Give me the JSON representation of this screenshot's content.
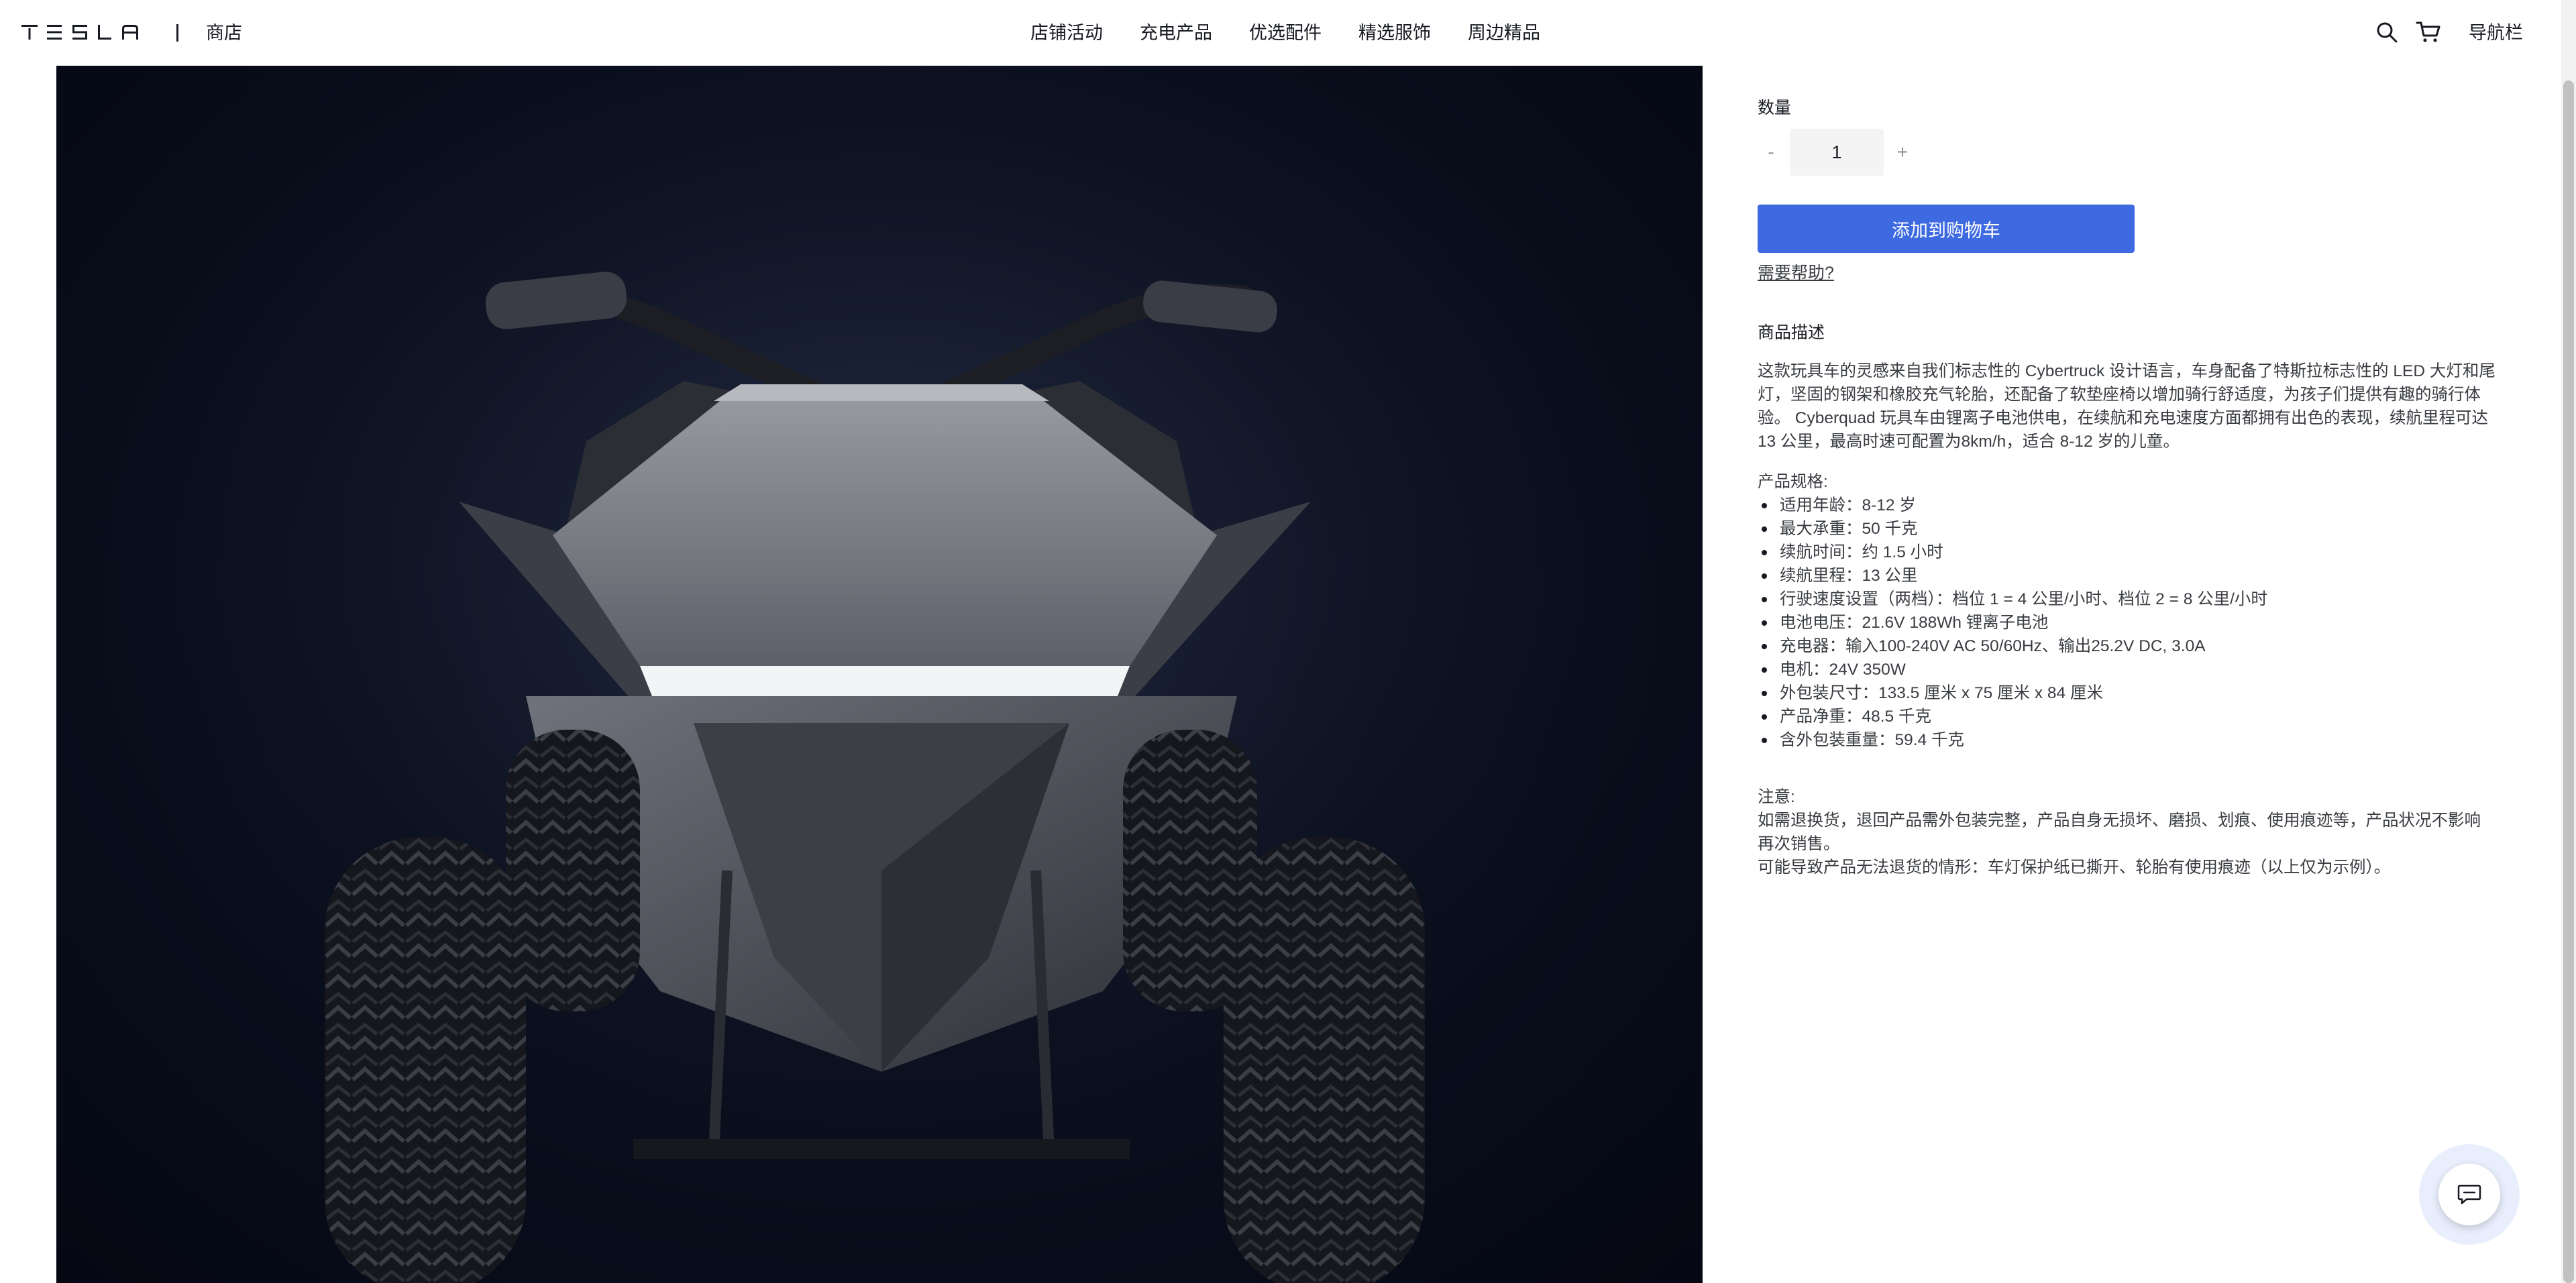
{
  "nav": {
    "brand": "TESLA",
    "store": "商店",
    "menu": [
      "店铺活动",
      "充电产品",
      "优选配件",
      "精选服饰",
      "周边精品"
    ],
    "icons": [
      "search-icon",
      "cart-icon"
    ],
    "menu_label": "导航栏"
  },
  "product": {
    "quantity_label": "数量",
    "quantity_minus": "-",
    "quantity_value": "1",
    "quantity_plus": "+",
    "add_to_cart": "添加到购物车",
    "help": "需要帮助?",
    "description_title": "商品描述",
    "description": "这款玩具车的灵感来自我们标志性的 Cybertruck 设计语言，车身配备了特斯拉标志性的 LED 大灯和尾灯，坚固的钢架和橡胶充气轮胎，还配备了软垫座椅以增加骑行舒适度，为孩子们提供有趣的骑行体验。 Cyberquad 玩具车由锂离子电池供电，在续航和充电速度方面都拥有出色的表现，续航里程可达 13 公里，最高时速可配置为8km/h，适合 8-12 岁的儿童。",
    "specs_title": "产品规格:",
    "specs": [
      "适用年龄：8-12 岁",
      "最大承重：50 千克",
      "续航时间：约 1.5 小时",
      "续航里程：13 公里",
      "行驶速度设置（两档）：档位 1 = 4 公里/小时、档位 2 = 8 公里/小时",
      "电池电压：21.6V 188Wh 锂离子电池",
      "充电器：输入100-240V AC 50/60Hz、输出25.2V DC, 3.0A",
      "电机：24V 350W",
      "外包装尺寸：133.5 厘米 x 75 厘米 x 84 厘米",
      "产品净重：48.5 千克",
      "含外包装重量：59.4 千克"
    ],
    "note_title": "注意:",
    "note_1": "如需退换货，退回产品需外包装完整，产品自身无损坏、磨损、划痕、使用痕迹等，产品状况不影响再次销售。",
    "note_2": "可能导致产品无法退货的情形：车灯保护纸已撕开、轮胎有使用痕迹（以上仅为示例）。"
  },
  "chat": {
    "icon": "chat-icon"
  },
  "colors": {
    "accent": "#3e6ae1",
    "text": "#171a20",
    "muted": "#393c41"
  }
}
